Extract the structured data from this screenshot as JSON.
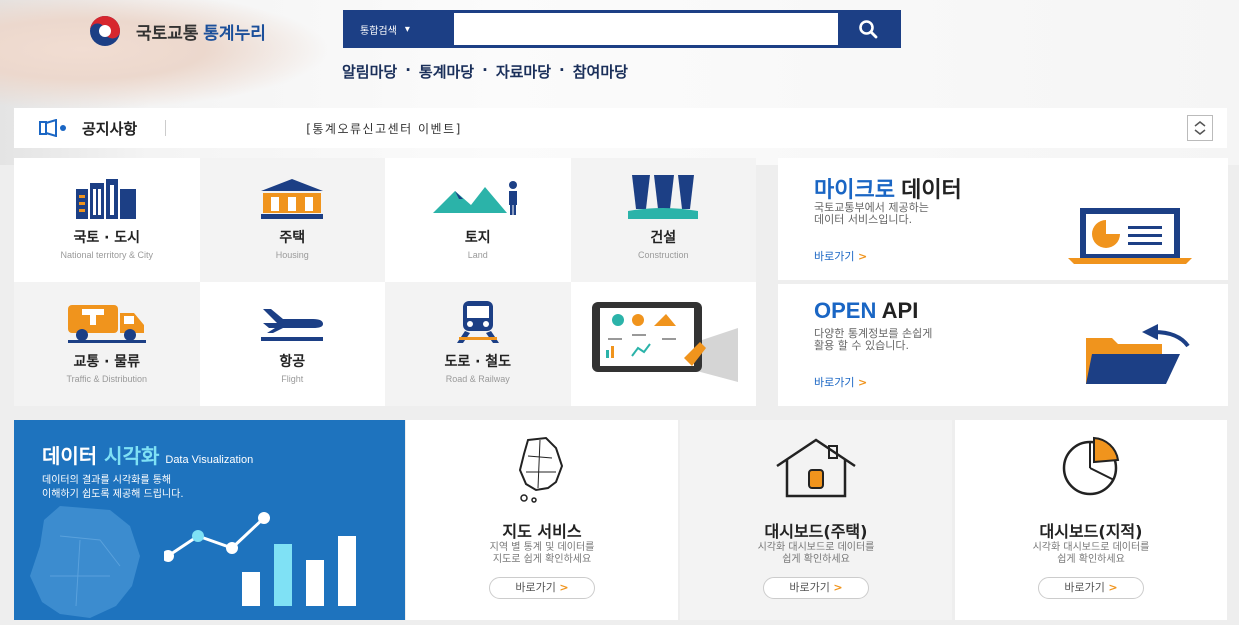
{
  "header": {
    "logo_prefix": "국토교통",
    "logo_main": "통계누리",
    "search": {
      "select_label": "통합검색",
      "placeholder": "",
      "value": ""
    },
    "nav": [
      "알림마당",
      "통계마당",
      "자료마당",
      "참여마당"
    ],
    "nav_separator": "·"
  },
  "notice": {
    "title": "공지사항",
    "text": "[통계오류신고센터 이벤트]"
  },
  "categories": [
    {
      "ko": "국토 · 도시",
      "en": "National territory & City",
      "icon": "city-icon"
    },
    {
      "ko": "주택",
      "en": "Housing",
      "icon": "house-icon"
    },
    {
      "ko": "토지",
      "en": "Land",
      "icon": "land-icon"
    },
    {
      "ko": "건설",
      "en": "Construction",
      "icon": "construction-icon"
    },
    {
      "ko": "교통 · 물류",
      "en": "Traffic & Distribution",
      "icon": "truck-icon"
    },
    {
      "ko": "항공",
      "en": "Flight",
      "icon": "airplane-icon"
    },
    {
      "ko": "도로 · 철도",
      "en": "Road & Railway",
      "icon": "train-icon"
    }
  ],
  "micro": {
    "title_colored": "마이크로",
    "title_rest": " 데이터",
    "desc1": "국토교통부에서 제공하는",
    "desc2": "데이터 서비스입니다.",
    "link": "바로가기",
    "arrow": ">"
  },
  "openapi": {
    "title_colored": "OPEN",
    "title_rest": " API",
    "desc1": "다양한 통계정보를 손쉽게",
    "desc2": "활용 할 수 있습니다.",
    "link": "바로가기",
    "arrow": ">"
  },
  "viz": {
    "title_white": "데이터",
    "title_cyan": "시각화",
    "title_en": "Data Visualization",
    "desc1": "데이터의 결과를 시각화를 통해",
    "desc2": "이해하기 쉽도록 제공해 드립니다."
  },
  "services": [
    {
      "title": "지도 서비스",
      "desc1": "지역 별 통계 및 데이터를",
      "desc2": "지도로 쉽게 확인하세요",
      "button": "바로가기",
      "arrow": ">"
    },
    {
      "title": "대시보드(주택)",
      "desc1": "시각화 대시보드로 데이터를",
      "desc2": "쉽게 확인하세요",
      "button": "바로가기",
      "arrow": ">"
    },
    {
      "title": "대시보드(지적)",
      "desc1": "시각화 대시보드로 데이터를",
      "desc2": "쉽게 확인하세요",
      "button": "바로가기",
      "arrow": ">"
    }
  ],
  "colors": {
    "navy": "#1c3f85",
    "blue": "#1e73be",
    "accent": "#1a66c4",
    "orange": "#f0941d",
    "teal": "#2bb3a9"
  }
}
